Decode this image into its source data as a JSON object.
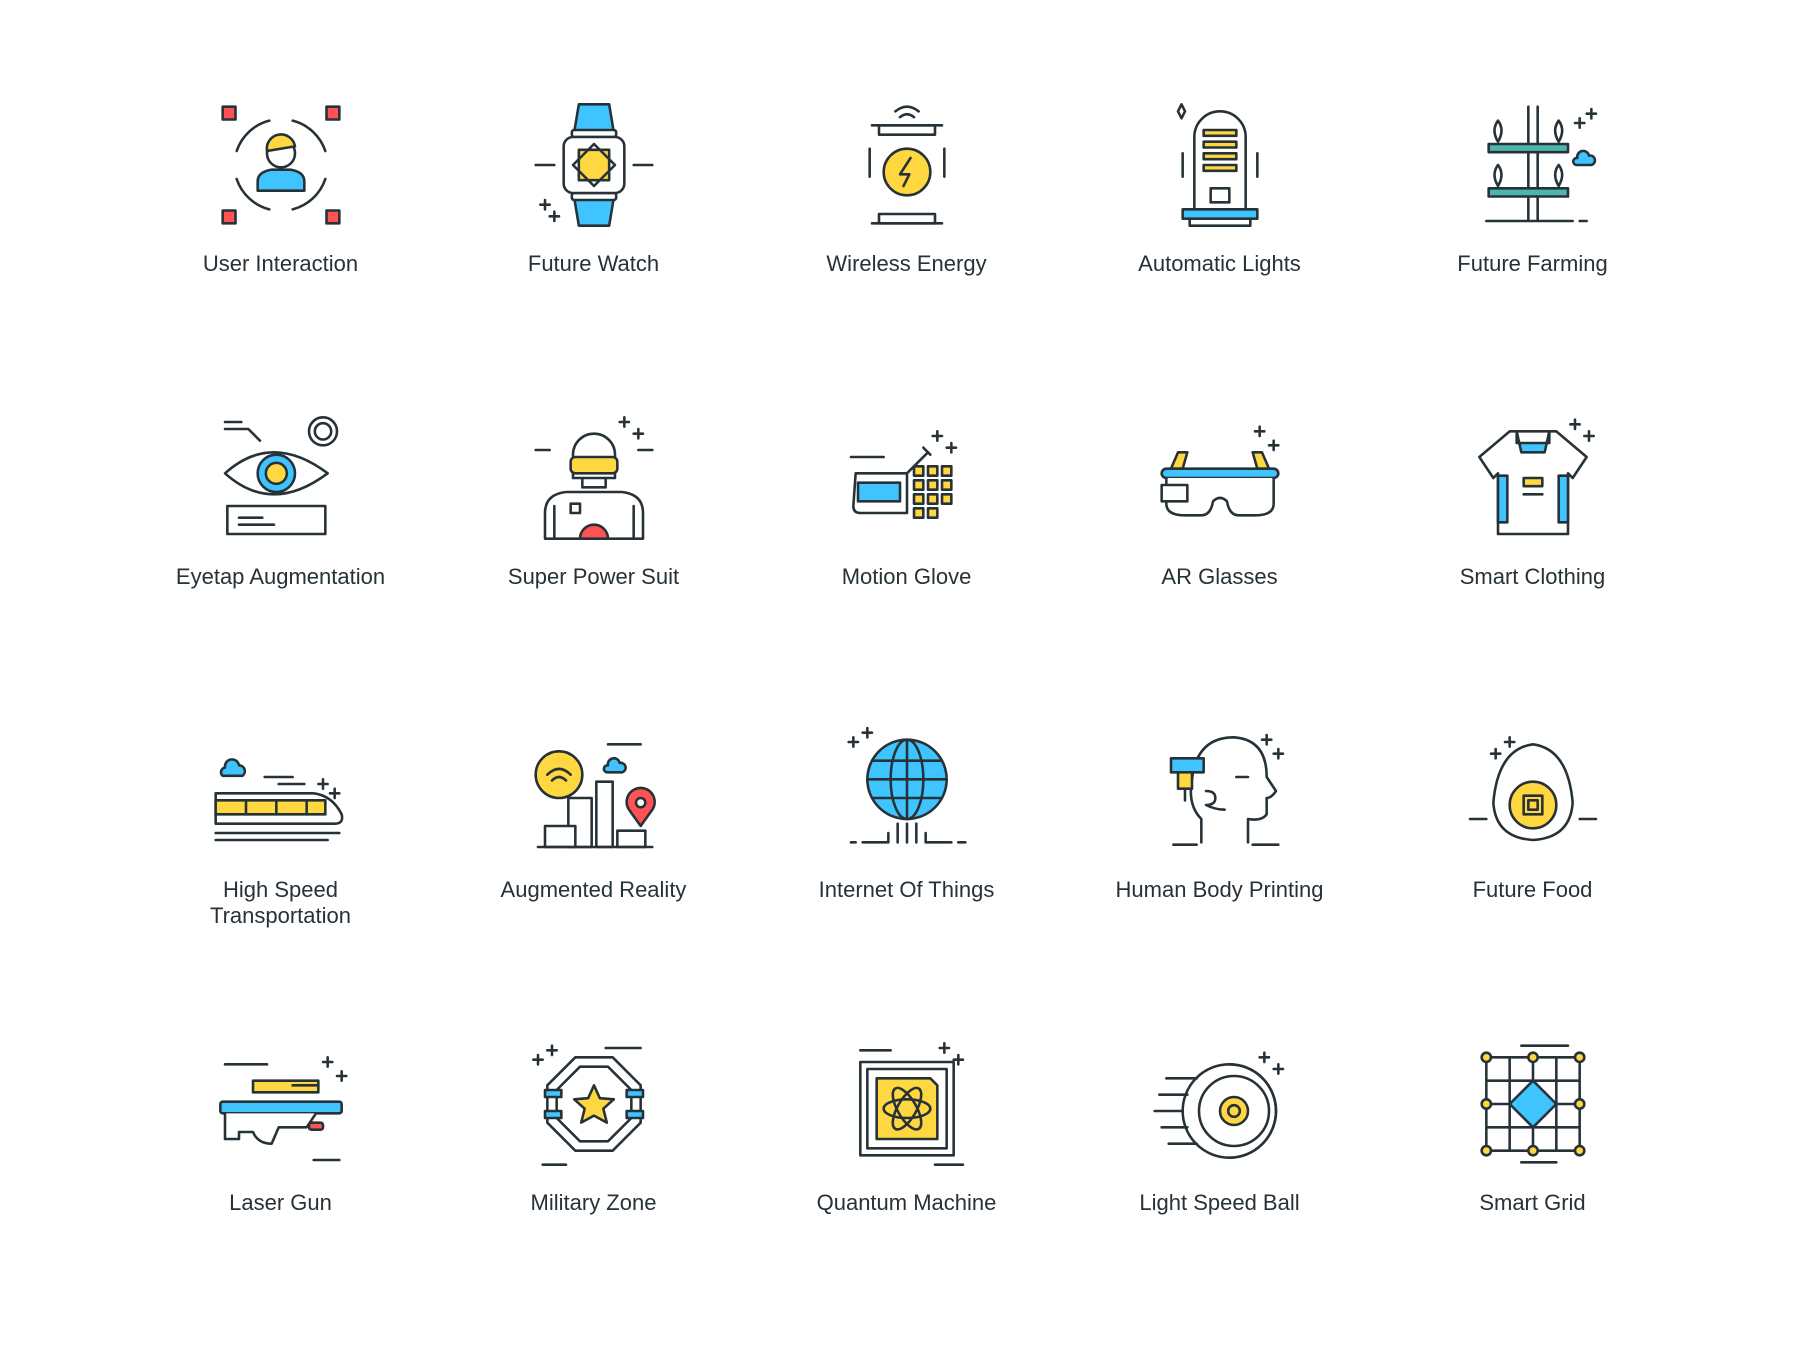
{
  "colors": {
    "blue": "#40c4ff",
    "yellow": "#ffd740",
    "red": "#ff5252",
    "teal": "#4db6ac",
    "stroke": "#263238"
  },
  "icons": [
    {
      "label": "User Interaction",
      "icon": "user-interaction-icon"
    },
    {
      "label": "Future Watch",
      "icon": "smartwatch-icon"
    },
    {
      "label": "Wireless Energy",
      "icon": "wireless-energy-icon"
    },
    {
      "label": "Automatic Lights",
      "icon": "lamp-icon"
    },
    {
      "label": "Future Farming",
      "icon": "farming-icon"
    },
    {
      "label": "Eyetap Augmentation",
      "icon": "eye-icon"
    },
    {
      "label": "Super Power Suit",
      "icon": "power-suit-icon"
    },
    {
      "label": "Motion Glove",
      "icon": "glove-icon"
    },
    {
      "label": "AR Glasses",
      "icon": "ar-glasses-icon"
    },
    {
      "label": "Smart Clothing",
      "icon": "shirt-icon"
    },
    {
      "label": "High Speed Transportation",
      "icon": "train-icon"
    },
    {
      "label": "Augmented Reality",
      "icon": "city-location-icon"
    },
    {
      "label": "Internet Of Things",
      "icon": "globe-icon"
    },
    {
      "label": "Human Body Printing",
      "icon": "head-printer-icon"
    },
    {
      "label": "Future Food",
      "icon": "egg-chip-icon"
    },
    {
      "label": "Laser Gun",
      "icon": "laser-gun-icon"
    },
    {
      "label": "Military Zone",
      "icon": "military-star-icon"
    },
    {
      "label": "Quantum Machine",
      "icon": "atom-chip-icon"
    },
    {
      "label": "Light Speed Ball",
      "icon": "speed-ball-icon"
    },
    {
      "label": "Smart Grid",
      "icon": "grid-icon"
    }
  ]
}
